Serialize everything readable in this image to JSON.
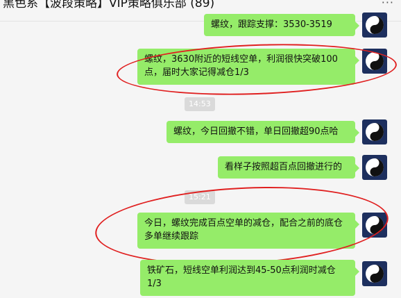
{
  "window": {
    "title": "黑色系【波段策略】VIP策略俱乐部 (89)",
    "more_icon": "more-dots-icon"
  },
  "messages": [
    {
      "type": "msg",
      "text": "螺纹，跟踪支撑：3530-3519",
      "avatar_icon": "yin-yang-icon"
    },
    {
      "type": "msg",
      "text": "螺纹，3630附近的短线空单，利润很快突破100点，届时大家记得减仓1/3",
      "avatar_icon": "yin-yang-icon",
      "highlighted": true
    },
    {
      "type": "time",
      "text": "14:53"
    },
    {
      "type": "msg",
      "text": "螺纹，今日回撤不错，单日回撤超90点哈",
      "avatar_icon": "yin-yang-icon"
    },
    {
      "type": "msg",
      "text": "看样子按照超百点回撤进行的",
      "avatar_icon": "yin-yang-icon"
    },
    {
      "type": "time",
      "text": "15:21"
    },
    {
      "type": "msg",
      "text": "今日，螺纹完成百点空单的减仓，配合之前的底仓多单继续跟踪",
      "avatar_icon": "yin-yang-icon",
      "highlighted": true
    },
    {
      "type": "msg",
      "text": "铁矿石，短线空单利润达到45-50点利润时减仓1/3",
      "avatar_icon": "yin-yang-icon"
    }
  ],
  "colors": {
    "bubble": "#95ec69",
    "annotation": "#e02020",
    "avatar_bg": "#1d2f5e"
  }
}
